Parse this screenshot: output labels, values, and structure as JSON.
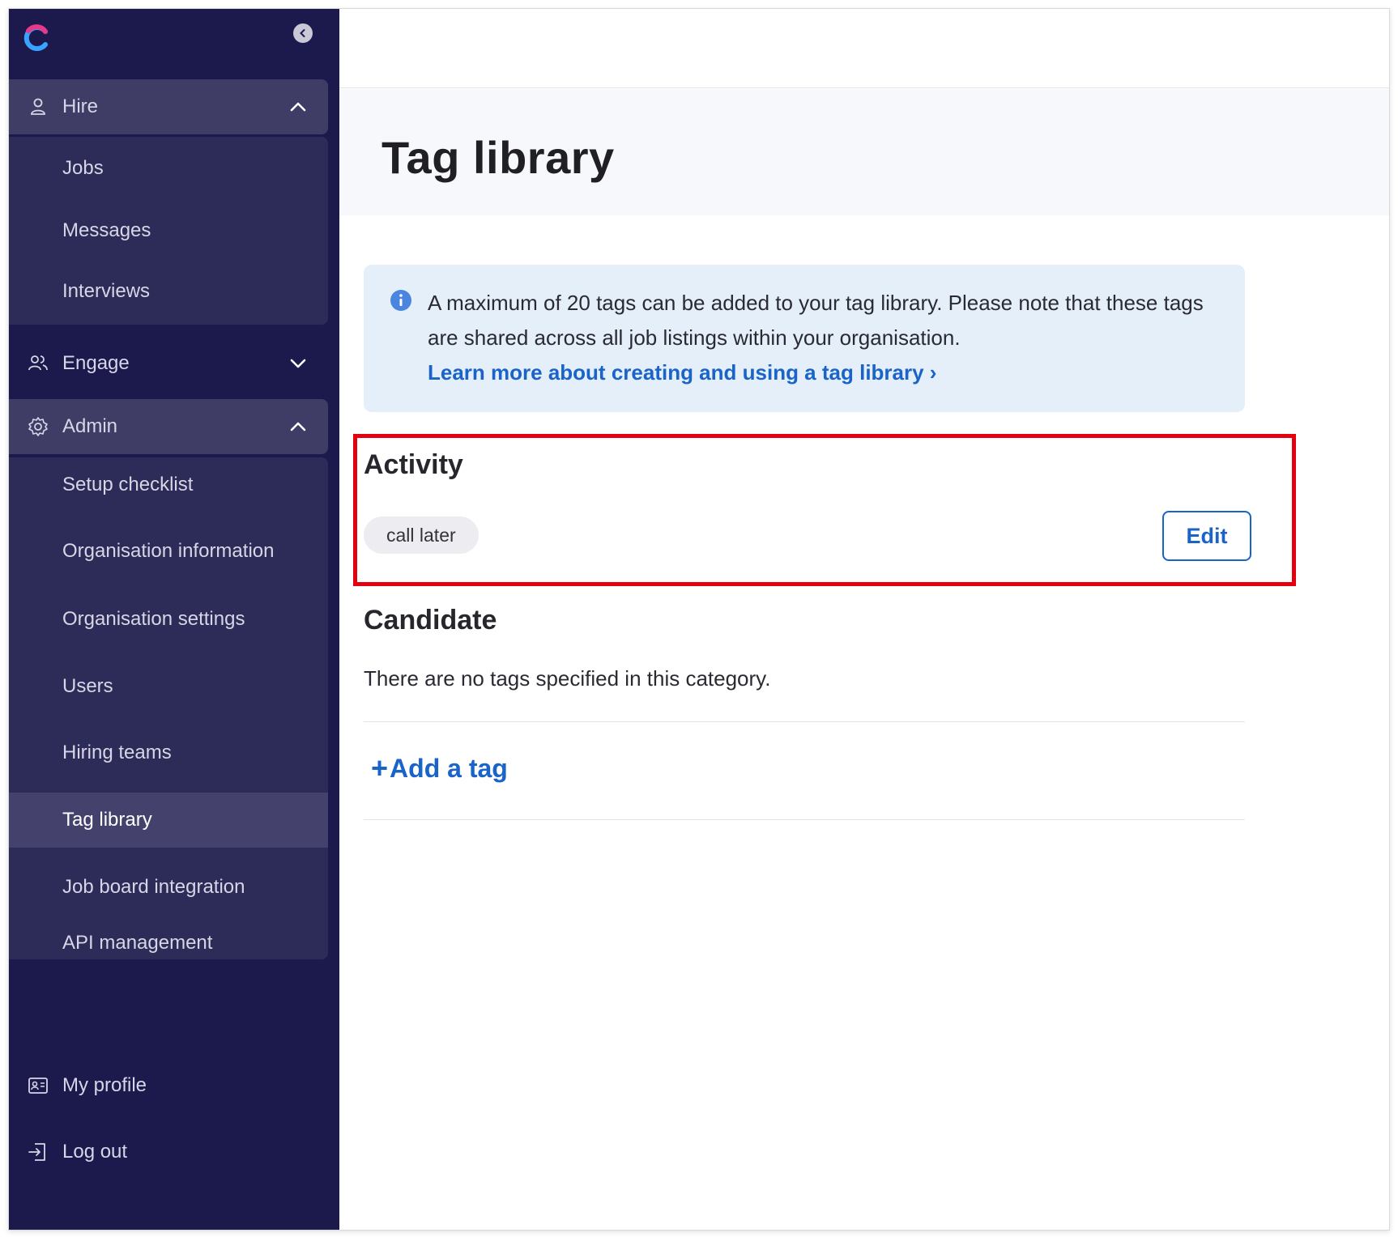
{
  "sidebar": {
    "hire": {
      "label": "Hire",
      "items": [
        "Jobs",
        "Messages",
        "Interviews"
      ]
    },
    "engage": {
      "label": "Engage"
    },
    "admin": {
      "label": "Admin",
      "items": [
        "Setup checklist",
        "Organisation information",
        "Organisation settings",
        "Users",
        "Hiring teams",
        "Tag library",
        "Job board integration",
        "API management"
      ],
      "active": "Tag library"
    },
    "profile": {
      "label": "My profile"
    },
    "logout": {
      "label": "Log out"
    }
  },
  "page": {
    "title": "Tag library"
  },
  "info": {
    "text": "A maximum of 20 tags can be added to your tag library. Please note that these tags are shared across all job listings within your organisation.",
    "link": "Learn more about creating and using a tag library ›"
  },
  "activity": {
    "title": "Activity",
    "tags": [
      "call later"
    ],
    "edit_label": "Edit"
  },
  "candidate": {
    "title": "Candidate",
    "empty": "There are no tags specified in this category."
  },
  "add_tag": {
    "plus": "+",
    "label": "Add a tag"
  },
  "colors": {
    "sidebar_bg": "#1c1a4d",
    "accent": "#1a63c9",
    "highlight": "#e3000f"
  }
}
